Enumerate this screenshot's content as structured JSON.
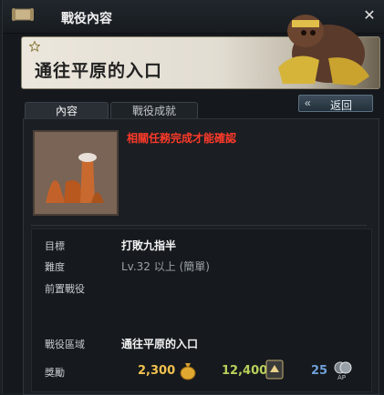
{
  "window": {
    "title": "戰役內容"
  },
  "banner": {
    "quest_name": "通往平原的入口"
  },
  "back_button": {
    "label": "返回"
  },
  "tabs": [
    {
      "label": "內容",
      "active": true
    },
    {
      "label": "戰役成就",
      "active": false
    }
  ],
  "requirement_notice": "相關任務完成才能確認",
  "details": {
    "goal_label": "目標",
    "goal_value": "打敗九指半",
    "difficulty_label": "難度",
    "difficulty_value": "Lv.32 以上 (簡單)",
    "prereq_label": "前置戰役",
    "area_label": "戰役區域",
    "area_value": "通往平原的入口",
    "reward_label": "獎勵"
  },
  "rewards": {
    "gold": "2,300",
    "exp": "12,400",
    "ap": "25"
  },
  "colors": {
    "notice": "#ff3a2a",
    "gold": "#f2c14e",
    "exp": "#b8d05a",
    "ap": "#6f9fd8"
  },
  "icons": [
    "scroll-icon",
    "close-icon",
    "star-icon",
    "back-arrows-icon",
    "gold-pouch-icon",
    "exp-icon",
    "ap-icon"
  ]
}
